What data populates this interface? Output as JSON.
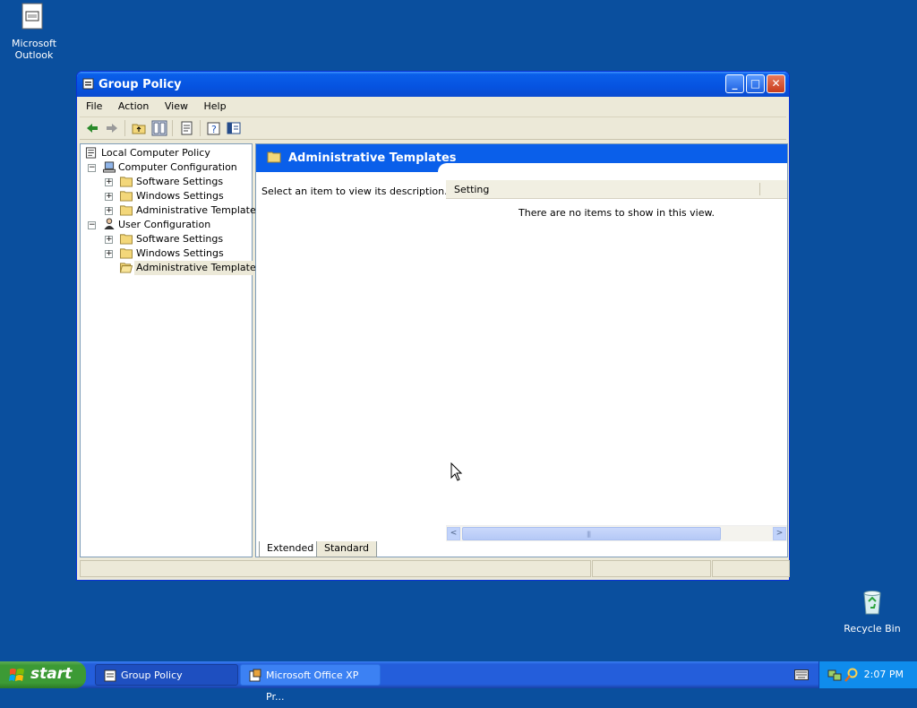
{
  "desktop": {
    "outlook_label": "Microsoft Outlook",
    "recycle_label": "Recycle Bin"
  },
  "window": {
    "title": "Group Policy",
    "menu": [
      "File",
      "Action",
      "View",
      "Help"
    ],
    "controls": {
      "minimize": "_",
      "maximize": "□",
      "close": "✕"
    }
  },
  "tree": {
    "root": "Local Computer Policy",
    "computer_config": "Computer Configuration",
    "user_config": "User Configuration",
    "cc_software": "Software Settings",
    "cc_windows": "Windows Settings",
    "cc_admin": "Administrative Templates",
    "uc_software": "Software Settings",
    "uc_windows": "Windows Settings",
    "uc_admin": "Administrative Templates"
  },
  "details": {
    "banner_title": "Administrative Templates",
    "description": "Select an item to view its description.",
    "column_header": "Setting",
    "empty_message": "There are no items to show in this view."
  },
  "tabs": {
    "extended": "Extended",
    "standard": "Standard"
  },
  "taskbar": {
    "start_label": "start",
    "tasks": [
      "Group Policy",
      "Microsoft Office XP Pr..."
    ],
    "clock": "2:07 PM"
  },
  "colors": {
    "desktop": "#0a4f9e",
    "titlebar": "#0a5fea",
    "banner": "#0a5fea",
    "start_button": "#3c9a35",
    "taskbar": "#245edb"
  },
  "icons": [
    "outlook-shortcut-icon",
    "recycle-bin-icon",
    "group-policy-icon",
    "back-arrow-icon",
    "forward-arrow-icon",
    "up-folder-icon",
    "show-hide-tree-icon",
    "export-list-icon",
    "help-icon",
    "properties-icon",
    "folder-icon",
    "computer-icon",
    "user-icon",
    "windows-logo-icon",
    "keyboard-icon",
    "network-icon",
    "search-icon"
  ]
}
